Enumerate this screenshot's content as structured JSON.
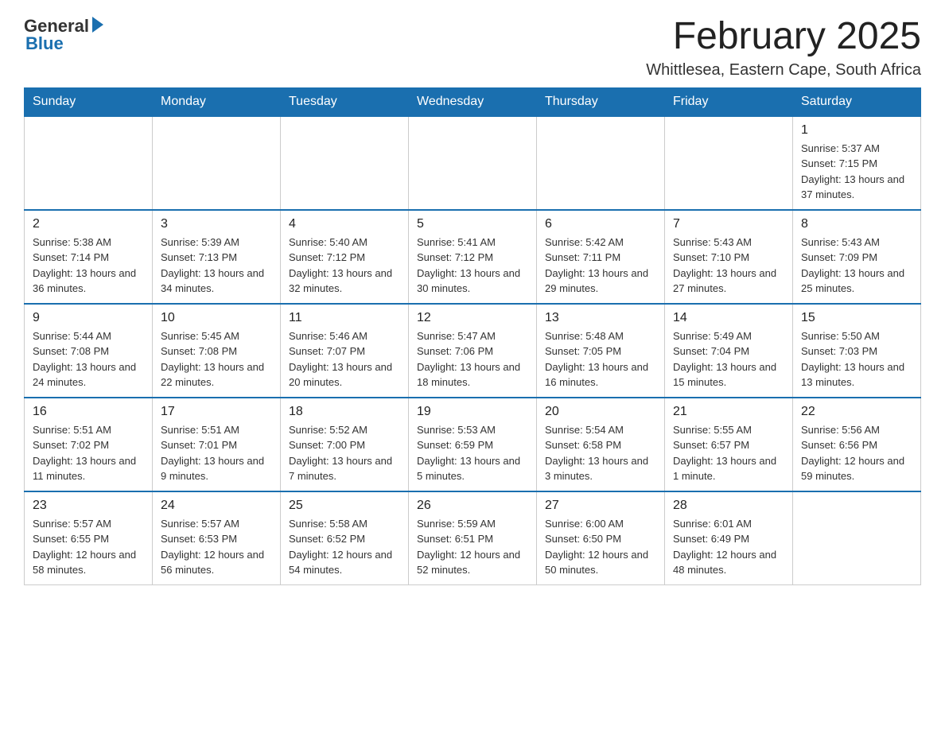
{
  "logo": {
    "general": "General",
    "blue": "Blue"
  },
  "header": {
    "month_year": "February 2025",
    "location": "Whittlesea, Eastern Cape, South Africa"
  },
  "days_of_week": [
    "Sunday",
    "Monday",
    "Tuesday",
    "Wednesday",
    "Thursday",
    "Friday",
    "Saturday"
  ],
  "weeks": [
    {
      "days": [
        {
          "num": "",
          "info": ""
        },
        {
          "num": "",
          "info": ""
        },
        {
          "num": "",
          "info": ""
        },
        {
          "num": "",
          "info": ""
        },
        {
          "num": "",
          "info": ""
        },
        {
          "num": "",
          "info": ""
        },
        {
          "num": "1",
          "info": "Sunrise: 5:37 AM\nSunset: 7:15 PM\nDaylight: 13 hours and 37 minutes."
        }
      ]
    },
    {
      "days": [
        {
          "num": "2",
          "info": "Sunrise: 5:38 AM\nSunset: 7:14 PM\nDaylight: 13 hours and 36 minutes."
        },
        {
          "num": "3",
          "info": "Sunrise: 5:39 AM\nSunset: 7:13 PM\nDaylight: 13 hours and 34 minutes."
        },
        {
          "num": "4",
          "info": "Sunrise: 5:40 AM\nSunset: 7:12 PM\nDaylight: 13 hours and 32 minutes."
        },
        {
          "num": "5",
          "info": "Sunrise: 5:41 AM\nSunset: 7:12 PM\nDaylight: 13 hours and 30 minutes."
        },
        {
          "num": "6",
          "info": "Sunrise: 5:42 AM\nSunset: 7:11 PM\nDaylight: 13 hours and 29 minutes."
        },
        {
          "num": "7",
          "info": "Sunrise: 5:43 AM\nSunset: 7:10 PM\nDaylight: 13 hours and 27 minutes."
        },
        {
          "num": "8",
          "info": "Sunrise: 5:43 AM\nSunset: 7:09 PM\nDaylight: 13 hours and 25 minutes."
        }
      ]
    },
    {
      "days": [
        {
          "num": "9",
          "info": "Sunrise: 5:44 AM\nSunset: 7:08 PM\nDaylight: 13 hours and 24 minutes."
        },
        {
          "num": "10",
          "info": "Sunrise: 5:45 AM\nSunset: 7:08 PM\nDaylight: 13 hours and 22 minutes."
        },
        {
          "num": "11",
          "info": "Sunrise: 5:46 AM\nSunset: 7:07 PM\nDaylight: 13 hours and 20 minutes."
        },
        {
          "num": "12",
          "info": "Sunrise: 5:47 AM\nSunset: 7:06 PM\nDaylight: 13 hours and 18 minutes."
        },
        {
          "num": "13",
          "info": "Sunrise: 5:48 AM\nSunset: 7:05 PM\nDaylight: 13 hours and 16 minutes."
        },
        {
          "num": "14",
          "info": "Sunrise: 5:49 AM\nSunset: 7:04 PM\nDaylight: 13 hours and 15 minutes."
        },
        {
          "num": "15",
          "info": "Sunrise: 5:50 AM\nSunset: 7:03 PM\nDaylight: 13 hours and 13 minutes."
        }
      ]
    },
    {
      "days": [
        {
          "num": "16",
          "info": "Sunrise: 5:51 AM\nSunset: 7:02 PM\nDaylight: 13 hours and 11 minutes."
        },
        {
          "num": "17",
          "info": "Sunrise: 5:51 AM\nSunset: 7:01 PM\nDaylight: 13 hours and 9 minutes."
        },
        {
          "num": "18",
          "info": "Sunrise: 5:52 AM\nSunset: 7:00 PM\nDaylight: 13 hours and 7 minutes."
        },
        {
          "num": "19",
          "info": "Sunrise: 5:53 AM\nSunset: 6:59 PM\nDaylight: 13 hours and 5 minutes."
        },
        {
          "num": "20",
          "info": "Sunrise: 5:54 AM\nSunset: 6:58 PM\nDaylight: 13 hours and 3 minutes."
        },
        {
          "num": "21",
          "info": "Sunrise: 5:55 AM\nSunset: 6:57 PM\nDaylight: 13 hours and 1 minute."
        },
        {
          "num": "22",
          "info": "Sunrise: 5:56 AM\nSunset: 6:56 PM\nDaylight: 12 hours and 59 minutes."
        }
      ]
    },
    {
      "days": [
        {
          "num": "23",
          "info": "Sunrise: 5:57 AM\nSunset: 6:55 PM\nDaylight: 12 hours and 58 minutes."
        },
        {
          "num": "24",
          "info": "Sunrise: 5:57 AM\nSunset: 6:53 PM\nDaylight: 12 hours and 56 minutes."
        },
        {
          "num": "25",
          "info": "Sunrise: 5:58 AM\nSunset: 6:52 PM\nDaylight: 12 hours and 54 minutes."
        },
        {
          "num": "26",
          "info": "Sunrise: 5:59 AM\nSunset: 6:51 PM\nDaylight: 12 hours and 52 minutes."
        },
        {
          "num": "27",
          "info": "Sunrise: 6:00 AM\nSunset: 6:50 PM\nDaylight: 12 hours and 50 minutes."
        },
        {
          "num": "28",
          "info": "Sunrise: 6:01 AM\nSunset: 6:49 PM\nDaylight: 12 hours and 48 minutes."
        },
        {
          "num": "",
          "info": ""
        }
      ]
    }
  ]
}
